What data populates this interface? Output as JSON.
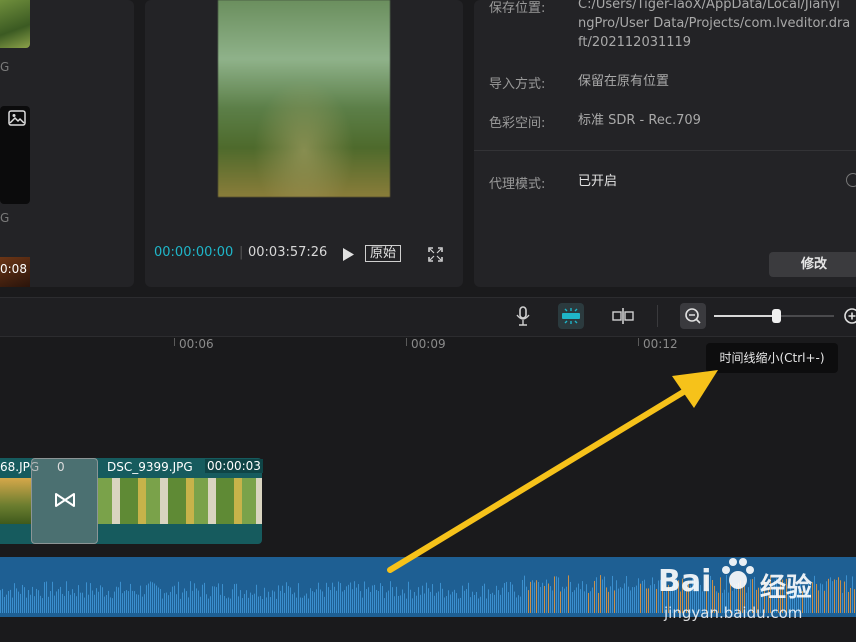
{
  "media": {
    "labels": [
      "G",
      "G"
    ],
    "thumb_duration": "0:08"
  },
  "player": {
    "current_time": "00:00:00:00",
    "separator": "|",
    "total_time": "00:03:57:26",
    "original_label": "原始"
  },
  "info": {
    "rows": [
      {
        "label": "保存位置:",
        "value_lines": [
          "C:/Users/Tiger-laoX/AppData/Local/Jianyi",
          "ngPro/User Data/Projects/com.lveditor.dra",
          "ft/202112031119"
        ]
      },
      {
        "label": "导入方式:",
        "value": "保留在原有位置"
      },
      {
        "label": "色彩空间:",
        "value": "标准 SDR - Rec.709"
      },
      {
        "label": "代理模式:",
        "value": "已开启"
      }
    ],
    "modify_label": "修改"
  },
  "timeline": {
    "ruler": [
      "00:06",
      "00:09",
      "00:12"
    ],
    "tooltip": "时间线缩小(Ctrl+-)",
    "zoom_level": 0.52,
    "clip_prev_name": "68.JPG",
    "transition_duration": "0",
    "clip_name": "DSC_9399.JPG",
    "clip_duration": "00:00:03"
  },
  "watermark": {
    "brand": "Bai",
    "brand2": "经验",
    "url": "jingyan.baidu.com"
  },
  "colors": {
    "accent": "#1fb6c9",
    "arrow": "#f6c21a",
    "clip": "#165b5e",
    "audio": "#1e5f93"
  },
  "icons": [
    "image-icon",
    "play-icon",
    "fullscreen-icon",
    "microphone-icon",
    "link-icon",
    "split-icon",
    "zoom-out-icon",
    "zoom-in-icon",
    "transition-icon"
  ]
}
